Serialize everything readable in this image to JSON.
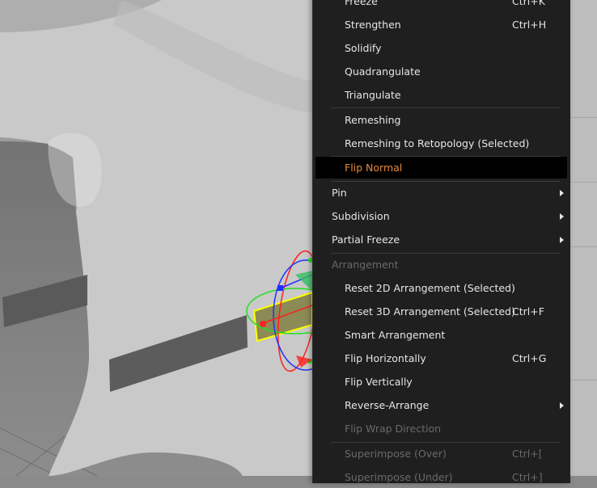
{
  "menu": {
    "items": [
      {
        "label": "Freeze",
        "shortcut": "Ctrl+K"
      },
      {
        "label": "Strengthen",
        "shortcut": "Ctrl+H"
      },
      {
        "label": "Solidify",
        "shortcut": ""
      },
      {
        "label": "Quadrangulate",
        "shortcut": ""
      },
      {
        "label": "Triangulate",
        "shortcut": ""
      },
      {
        "label": "Remeshing",
        "shortcut": ""
      },
      {
        "label": "Remeshing to Retopology (Selected)",
        "shortcut": ""
      },
      {
        "label": "Flip Normal",
        "shortcut": "",
        "state": "highlighted"
      },
      {
        "label": "Pin",
        "submenu": true
      },
      {
        "label": "Subdivision",
        "submenu": true
      },
      {
        "label": "Partial Freeze",
        "submenu": true
      },
      {
        "label": "Arrangement",
        "state": "disabled-header"
      },
      {
        "label": "Reset 2D Arrangement (Selected)",
        "shortcut": ""
      },
      {
        "label": "Reset 3D Arrangement (Selected)",
        "shortcut": "Ctrl+F"
      },
      {
        "label": "Smart Arrangement",
        "shortcut": ""
      },
      {
        "label": "Flip Horizontally",
        "shortcut": "Ctrl+G"
      },
      {
        "label": "Flip Vertically",
        "shortcut": ""
      },
      {
        "label": "Reverse-Arrange",
        "submenu": true
      },
      {
        "label": "Flip Wrap Direction",
        "state": "disabled"
      },
      {
        "label": "Superimpose (Over)",
        "shortcut": "Ctrl+[",
        "state": "disabled"
      },
      {
        "label": "Superimpose (Under)",
        "shortcut": "Ctrl+]",
        "state": "disabled"
      }
    ]
  },
  "colors": {
    "menu_bg": "#1f1f1f",
    "highlight_text": "#e8893a",
    "disabled_text": "#6a6a6a",
    "gizmo_red": "#ff2020",
    "gizmo_green": "#20e020",
    "gizmo_blue": "#2030ff",
    "selection_yellow": "#ffff00"
  }
}
